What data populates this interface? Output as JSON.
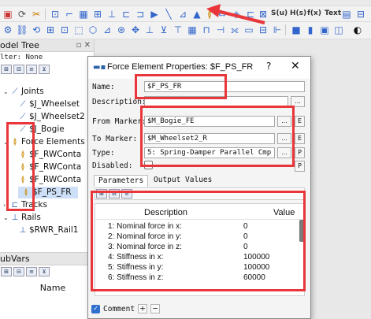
{
  "toolbar_text": {
    "s_u": "S(u)",
    "h_s": "H(s)",
    "f_x": "f(x)",
    "text": "Text"
  },
  "tree": {
    "title": "odel Tree",
    "filter": "lter: None",
    "items": [
      {
        "label": "Joints"
      },
      {
        "label": "$J_Wheelset"
      },
      {
        "label": "$J_Wheelset2"
      },
      {
        "label": "$J_Bogie"
      },
      {
        "label": "Force Elements"
      },
      {
        "label": "$F_RWConta"
      },
      {
        "label": "$F_RWConta"
      },
      {
        "label": "$F_RWConta"
      },
      {
        "label": "$F_PS_FR"
      },
      {
        "label": "Tracks"
      },
      {
        "label": "Rails"
      },
      {
        "label": "$RWR_Rail1"
      }
    ]
  },
  "subvars": {
    "title": "ubVars",
    "column_name": "Name"
  },
  "dialog": {
    "title": "Force Element Properties: $F_PS_FR",
    "help": "?",
    "close": "✕",
    "fields": {
      "name_label": "Name:",
      "name_value": "$F_PS_FR",
      "description_label": "Description:",
      "description_value": "",
      "from_marker_label": "From Marker:",
      "from_marker_value": "$M_Bogie_FE",
      "to_marker_label": "To Marker:",
      "to_marker_value": "$M_Wheelset2_R",
      "type_label": "Type:",
      "type_value": "5: Spring-Damper Parallel Cmp",
      "disabled_label": "Disabled:"
    },
    "buttons": {
      "ellipsis": "...",
      "e": "E",
      "p": "P"
    },
    "tabs": [
      "Parameters",
      "Output Values"
    ],
    "params_header": {
      "description": "Description",
      "value": "Value"
    },
    "params": [
      {
        "desc": "1: Nominal force in x:",
        "value": "0"
      },
      {
        "desc": "2: Nominal force in y:",
        "value": "0"
      },
      {
        "desc": "3: Nominal force in z:",
        "value": "0"
      },
      {
        "desc": "4: Stiffness in x:",
        "value": "100000"
      },
      {
        "desc": "5: Stiffness in y:",
        "value": "100000"
      },
      {
        "desc": "6: Stiffness in z:",
        "value": "60000"
      }
    ],
    "comment_label": "Comment",
    "plus": "+",
    "minus": "−"
  },
  "colors": {
    "highlight": "#e8363b",
    "accent": "#2f6fcd"
  }
}
